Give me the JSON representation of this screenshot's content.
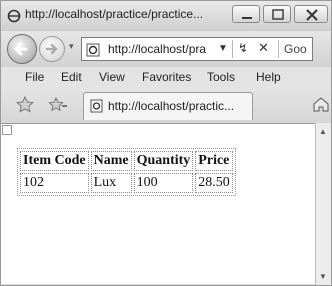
{
  "window": {
    "title": "http://localhost/practice/practice..."
  },
  "address_bar": {
    "url": "http://localhost/pra",
    "search_text": "Goo"
  },
  "menu": {
    "file": "File",
    "edit": "Edit",
    "view": "View",
    "favorites": "Favorites",
    "tools": "Tools",
    "help": "Help"
  },
  "tab": {
    "title": "http://localhost/practic..."
  },
  "table": {
    "headers": [
      "Item Code",
      "Name",
      "Quantity",
      "Price"
    ],
    "rows": [
      [
        "102",
        "Lux",
        "100",
        "28.50"
      ]
    ]
  },
  "colors": {
    "chrome": "#dcdcdc",
    "content_bg": "#ffffff"
  },
  "icons": [
    "ie-page-icon",
    "minimize-icon",
    "maximize-icon",
    "close-icon",
    "back-arrow-icon",
    "forward-arrow-icon",
    "refresh-icon",
    "stop-icon",
    "favorites-star-icon",
    "add-favorites-icon",
    "home-icon"
  ]
}
